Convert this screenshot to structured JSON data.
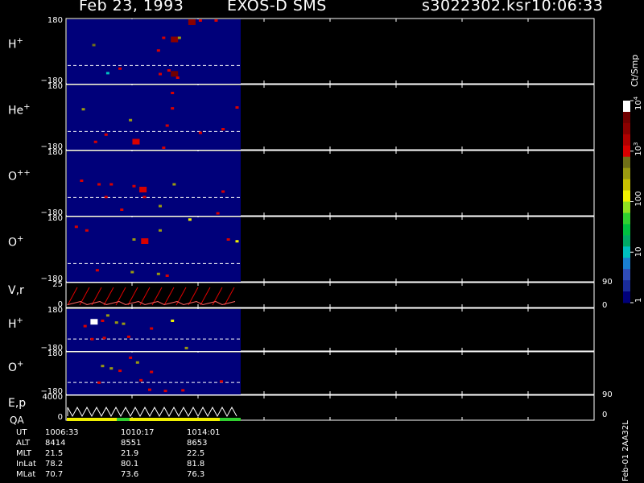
{
  "header": {
    "date": "Feb 23, 1993",
    "instrument": "EXOS-D SMS",
    "filename": "s3022302.ksr",
    "time": "10:06:33"
  },
  "colorbar": {
    "unit_label": "Ct/Smp",
    "ticks": [
      {
        "label": "1",
        "value": 1
      },
      {
        "label": "10",
        "value": 10
      },
      {
        "label": "100",
        "value": 100
      },
      {
        "label": "10",
        "sup": "3",
        "value": 1000
      },
      {
        "label": "10",
        "sup": "4",
        "value": 10000
      }
    ],
    "colors": [
      "#00007a",
      "#1a2c9a",
      "#2f4db8",
      "#1a7fd0",
      "#00c0c0",
      "#00aa66",
      "#00c040",
      "#30d030",
      "#90e020",
      "#f0f000",
      "#c8c000",
      "#9a9a10",
      "#707018",
      "#d80000",
      "#b00000",
      "#8a0000",
      "#700000",
      "#ffffff"
    ]
  },
  "panels": [
    {
      "id": "h-plus-1",
      "species": "H",
      "charge": "+",
      "ymax": "180",
      "ymin": "−180"
    },
    {
      "id": "he-plus",
      "species": "He",
      "charge": "+",
      "ymax": "180",
      "ymin": "−180"
    },
    {
      "id": "o-plus-plus",
      "species": "O",
      "charge": "++",
      "ymax": "180",
      "ymin": "−180"
    },
    {
      "id": "o-plus-1",
      "species": "O",
      "charge": "+",
      "ymax": "180",
      "ymin": "−180"
    },
    {
      "id": "vr",
      "species": "V,r",
      "charge": "",
      "ymax": "25",
      "ymin": "0",
      "right_max": "90",
      "right_min": "0"
    },
    {
      "id": "h-plus-2",
      "species": "H",
      "charge": "+",
      "ymax": "180",
      "ymin": "−180"
    },
    {
      "id": "o-plus-2",
      "species": "O",
      "charge": "+",
      "ymax": "180",
      "ymin": "−180"
    },
    {
      "id": "ep",
      "species": "E,p",
      "charge": "",
      "ymax": "4000",
      "ymin": "0",
      "right_max": "90",
      "right_min": "0"
    }
  ],
  "qa_label": "QA",
  "footer": {
    "rows": [
      {
        "label": "UT",
        "values": [
          "1006:33",
          "1010:17",
          "1014:01"
        ]
      },
      {
        "label": "ALT",
        "values": [
          "8414",
          "8551",
          "8653"
        ]
      },
      {
        "label": "MLT",
        "values": [
          "21.5",
          "21.9",
          "22.5"
        ]
      },
      {
        "label": "InLat",
        "values": [
          "78.2",
          "80.1",
          "81.8"
        ]
      },
      {
        "label": "MLat",
        "values": [
          "70.7",
          "73.6",
          "76.3"
        ]
      }
    ],
    "version": "Feb-01 2AA32L"
  },
  "chart_data": {
    "type": "heatmap",
    "title": "Feb 23, 1993   EXOS-D SMS",
    "x_ticks": [
      "1006:33",
      "1010:17",
      "1014:01"
    ],
    "colorbar_range": [
      1,
      10000
    ],
    "colorbar_scale": "log",
    "panels": [
      {
        "name": "H+",
        "ylim": [
          -180,
          180
        ],
        "events": [
          {
            "t": 0.76,
            "a": 178,
            "c": 1000
          },
          {
            "t": 0.7,
            "a": 178,
            "c": 3000
          },
          {
            "t": 0.85,
            "a": 178,
            "c": 1000
          },
          {
            "t": 0.55,
            "a": 80,
            "c": 1000
          },
          {
            "t": 0.6,
            "a": 80,
            "c": 3000
          },
          {
            "t": 0.64,
            "a": 80,
            "c": 500
          },
          {
            "t": 0.15,
            "a": 40,
            "c": 800
          },
          {
            "t": 0.52,
            "a": 10,
            "c": 1000
          },
          {
            "t": 0.3,
            "a": -90,
            "c": 1000
          },
          {
            "t": 0.58,
            "a": -100,
            "c": 1000
          },
          {
            "t": 0.23,
            "a": -115,
            "c": 10
          },
          {
            "t": 0.53,
            "a": -120,
            "c": 1000
          },
          {
            "t": 0.6,
            "a": -110,
            "c": 5000
          },
          {
            "t": 0.63,
            "a": -140,
            "c": 1000
          }
        ]
      },
      {
        "name": "He+",
        "ylim": [
          -180,
          180
        ],
        "events": [
          {
            "t": 0.6,
            "a": 140,
            "c": 1000
          },
          {
            "t": 0.09,
            "a": 50,
            "c": 500
          },
          {
            "t": 0.6,
            "a": 55,
            "c": 1000
          },
          {
            "t": 0.36,
            "a": -10,
            "c": 300
          },
          {
            "t": 0.57,
            "a": -40,
            "c": 1000
          },
          {
            "t": 0.22,
            "a": -90,
            "c": 1000
          },
          {
            "t": 0.38,
            "a": -120,
            "c": 1500
          },
          {
            "t": 0.16,
            "a": -130,
            "c": 1000
          },
          {
            "t": 0.55,
            "a": -170,
            "c": 1000
          },
          {
            "t": 0.76,
            "a": -80,
            "c": 1000
          },
          {
            "t": 0.89,
            "a": -60,
            "c": 1000
          },
          {
            "t": 0.97,
            "a": 60,
            "c": 1000
          }
        ]
      },
      {
        "name": "O++",
        "ylim": [
          -180,
          180
        ],
        "events": [
          {
            "t": 0.08,
            "a": 20,
            "c": 1000
          },
          {
            "t": 0.18,
            "a": 0,
            "c": 1000
          },
          {
            "t": 0.25,
            "a": 0,
            "c": 1000
          },
          {
            "t": 0.38,
            "a": -10,
            "c": 1000
          },
          {
            "t": 0.42,
            "a": -20,
            "c": 1500
          },
          {
            "t": 0.61,
            "a": 0,
            "c": 500
          },
          {
            "t": 0.22,
            "a": -70,
            "c": 1000
          },
          {
            "t": 0.44,
            "a": -70,
            "c": 1000
          },
          {
            "t": 0.53,
            "a": -120,
            "c": 500
          },
          {
            "t": 0.89,
            "a": -40,
            "c": 1000
          },
          {
            "t": 0.31,
            "a": -140,
            "c": 1000
          },
          {
            "t": 0.86,
            "a": -160,
            "c": 1000
          }
        ]
      },
      {
        "name": "O+",
        "ylim": [
          -180,
          180
        ],
        "events": [
          {
            "t": 0.7,
            "a": 170,
            "c": 100
          },
          {
            "t": 0.05,
            "a": 130,
            "c": 1000
          },
          {
            "t": 0.11,
            "a": 110,
            "c": 1000
          },
          {
            "t": 0.43,
            "a": 60,
            "c": 1500
          },
          {
            "t": 0.38,
            "a": 60,
            "c": 500
          },
          {
            "t": 0.92,
            "a": 60,
            "c": 1000
          },
          {
            "t": 0.97,
            "a": 50,
            "c": 100
          },
          {
            "t": 0.53,
            "a": 110,
            "c": 500
          },
          {
            "t": 0.17,
            "a": -110,
            "c": 1000
          },
          {
            "t": 0.52,
            "a": -130,
            "c": 500
          },
          {
            "t": 0.57,
            "a": -140,
            "c": 1000
          },
          {
            "t": 0.37,
            "a": -120,
            "c": 300
          }
        ]
      },
      {
        "name": "H+",
        "ylim": [
          -180,
          180
        ],
        "events": [
          {
            "t": 0.23,
            "a": 130,
            "c": 500
          },
          {
            "t": 0.14,
            "a": 90,
            "c": 10000
          },
          {
            "t": 0.2,
            "a": 85,
            "c": 1000
          },
          {
            "t": 0.28,
            "a": 70,
            "c": 500
          },
          {
            "t": 0.32,
            "a": 60,
            "c": 300
          },
          {
            "t": 0.48,
            "a": 20,
            "c": 1000
          },
          {
            "t": 0.6,
            "a": 85,
            "c": 100
          },
          {
            "t": 0.1,
            "a": 40,
            "c": 1000
          },
          {
            "t": 0.14,
            "a": -70,
            "c": 1000
          },
          {
            "t": 0.21,
            "a": -60,
            "c": 1000
          },
          {
            "t": 0.35,
            "a": -50,
            "c": 1000
          },
          {
            "t": 0.68,
            "a": -145,
            "c": 300
          }
        ]
      },
      {
        "name": "O+",
        "ylim": [
          -180,
          180
        ],
        "events": [
          {
            "t": 0.36,
            "a": 140,
            "c": 1000
          },
          {
            "t": 0.4,
            "a": 100,
            "c": 500
          },
          {
            "t": 0.2,
            "a": 70,
            "c": 300
          },
          {
            "t": 0.25,
            "a": 50,
            "c": 500
          },
          {
            "t": 0.3,
            "a": 30,
            "c": 1000
          },
          {
            "t": 0.48,
            "a": 20,
            "c": 1000
          },
          {
            "t": 0.18,
            "a": -70,
            "c": 1000
          },
          {
            "t": 0.42,
            "a": -50,
            "c": 1000
          },
          {
            "t": 0.47,
            "a": -130,
            "c": 1000
          },
          {
            "t": 0.56,
            "a": -140,
            "c": 1000
          },
          {
            "t": 0.66,
            "a": -135,
            "c": 1000
          },
          {
            "t": 0.88,
            "a": -60,
            "c": 1000
          }
        ]
      }
    ]
  }
}
